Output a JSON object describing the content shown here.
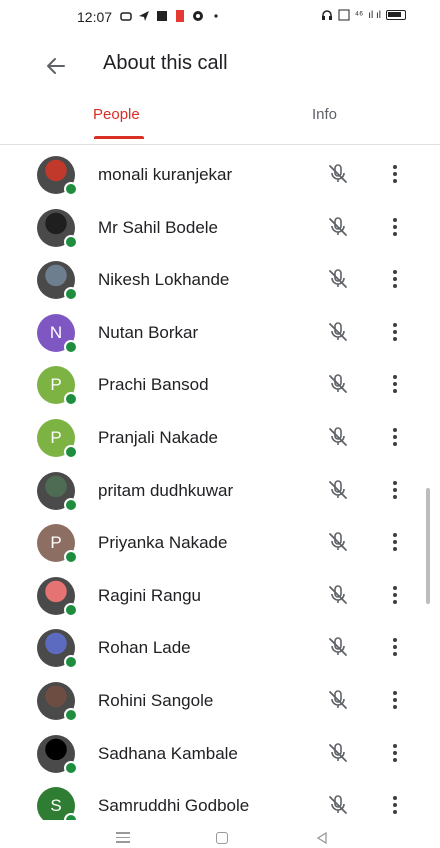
{
  "status_bar": {
    "time": "12:07",
    "network": "⁴⁶",
    "signal": "ıl ıl"
  },
  "header": {
    "title": "About this call"
  },
  "tabs": [
    {
      "label": "People",
      "active": true
    },
    {
      "label": "Info",
      "active": false
    }
  ],
  "participants": [
    {
      "name": "monali kuranjekar",
      "initial": "",
      "avatar_color": "#c0392b",
      "avatar_kind": "photo"
    },
    {
      "name": "Mr Sahil Bodele",
      "initial": "",
      "avatar_color": "#1f1f1f",
      "avatar_kind": "photo"
    },
    {
      "name": "Nikesh Lokhande",
      "initial": "",
      "avatar_color": "#6d7f8e",
      "avatar_kind": "photo"
    },
    {
      "name": "Nutan Borkar",
      "initial": "N",
      "avatar_color": "#7e57c2",
      "avatar_kind": "letter"
    },
    {
      "name": "Prachi Bansod",
      "initial": "P",
      "avatar_color": "#7cb342",
      "avatar_kind": "letter"
    },
    {
      "name": "Pranjali Nakade",
      "initial": "P",
      "avatar_color": "#7cb342",
      "avatar_kind": "letter"
    },
    {
      "name": "pritam dudhkuwar",
      "initial": "",
      "avatar_color": "#4e6b54",
      "avatar_kind": "photo"
    },
    {
      "name": "Priyanka Nakade",
      "initial": "P",
      "avatar_color": "#8d6e63",
      "avatar_kind": "letter"
    },
    {
      "name": "Ragini Rangu",
      "initial": "",
      "avatar_color": "#e57373",
      "avatar_kind": "photo"
    },
    {
      "name": "Rohan Lade",
      "initial": "",
      "avatar_color": "#5c6bc0",
      "avatar_kind": "photo"
    },
    {
      "name": "Rohini Sangole",
      "initial": "",
      "avatar_color": "#6d4c41",
      "avatar_kind": "photo"
    },
    {
      "name": "Sadhana Kambale",
      "initial": "",
      "avatar_color": "#000000",
      "avatar_kind": "photo"
    },
    {
      "name": "Samruddhi Godbole",
      "initial": "S",
      "avatar_color": "#2e7d32",
      "avatar_kind": "letter"
    }
  ],
  "icons": {
    "back": "arrow-left-icon",
    "mic": "mic-off-icon",
    "more": "more-vert-icon"
  },
  "colors": {
    "accent": "#d93025",
    "presence": "#1e8e3e"
  }
}
